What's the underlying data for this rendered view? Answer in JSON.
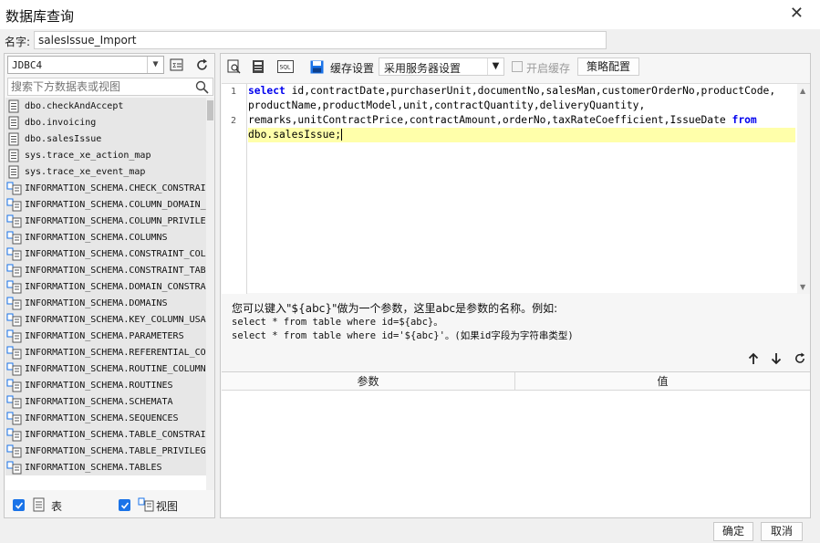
{
  "window": {
    "title": "数据库查询"
  },
  "name_field": {
    "label": "名字:",
    "value": "salesIssue_Import"
  },
  "left": {
    "connection": "JDBC4",
    "search_placeholder": "搜索下方数据表或视图",
    "items": [
      {
        "label": "dbo.checkAndAccept",
        "kind": "table"
      },
      {
        "label": "dbo.invoicing",
        "kind": "table"
      },
      {
        "label": "dbo.salesIssue",
        "kind": "table"
      },
      {
        "label": "sys.trace_xe_action_map",
        "kind": "table"
      },
      {
        "label": "sys.trace_xe_event_map",
        "kind": "table"
      },
      {
        "label": "INFORMATION_SCHEMA.CHECK_CONSTRAI",
        "kind": "view"
      },
      {
        "label": "INFORMATION_SCHEMA.COLUMN_DOMAIN_",
        "kind": "view"
      },
      {
        "label": "INFORMATION_SCHEMA.COLUMN_PRIVILE",
        "kind": "view"
      },
      {
        "label": "INFORMATION_SCHEMA.COLUMNS",
        "kind": "view"
      },
      {
        "label": "INFORMATION_SCHEMA.CONSTRAINT_COL",
        "kind": "view"
      },
      {
        "label": "INFORMATION_SCHEMA.CONSTRAINT_TAB",
        "kind": "view"
      },
      {
        "label": "INFORMATION_SCHEMA.DOMAIN_CONSTRA",
        "kind": "view"
      },
      {
        "label": "INFORMATION_SCHEMA.DOMAINS",
        "kind": "view"
      },
      {
        "label": "INFORMATION_SCHEMA.KEY_COLUMN_USA",
        "kind": "view"
      },
      {
        "label": "INFORMATION_SCHEMA.PARAMETERS",
        "kind": "view"
      },
      {
        "label": "INFORMATION_SCHEMA.REFERENTIAL_CO",
        "kind": "view"
      },
      {
        "label": "INFORMATION_SCHEMA.ROUTINE_COLUMN",
        "kind": "view"
      },
      {
        "label": "INFORMATION_SCHEMA.ROUTINES",
        "kind": "view"
      },
      {
        "label": "INFORMATION_SCHEMA.SCHEMATA",
        "kind": "view"
      },
      {
        "label": "INFORMATION_SCHEMA.SEQUENCES",
        "kind": "view"
      },
      {
        "label": "INFORMATION_SCHEMA.TABLE_CONSTRAI",
        "kind": "view"
      },
      {
        "label": "INFORMATION_SCHEMA.TABLE_PRIVILEG",
        "kind": "view"
      },
      {
        "label": "INFORMATION_SCHEMA.TABLES",
        "kind": "view"
      }
    ],
    "filter_table_label": "表",
    "filter_view_label": "视图",
    "filter_table_checked": true,
    "filter_view_checked": true
  },
  "toolbar": {
    "cache_settings_label": "缓存设置",
    "cache_mode": "采用服务器设置",
    "enable_cache_label": "开启缓存",
    "policy_button": "策略配置"
  },
  "editor": {
    "line_numbers": [
      "1",
      "2"
    ],
    "kw_select": "select",
    "kw_from": "from",
    "line1": " id,contractDate,purchaserUnit,documentNo,salesMan,customerOrderNo,productCode,",
    "line1b": "productName,productModel,unit,contractQuantity,deliveryQuantity,",
    "line2": "remarks,unitContractPrice,contractAmount,orderNo,taxRateCoefficient,IssueDate ",
    "line2b": "dbo.salesIssue;"
  },
  "hint": {
    "line1": "您可以键入\"${abc}\"做为一个参数，这里abc是参数的名称。例如:",
    "line2": "select * from table where id=${abc}。",
    "line3": "select * from table where id='${abc}'。(如果id字段为字符串类型)"
  },
  "params": {
    "col_param": "参数",
    "col_value": "值"
  },
  "footer": {
    "ok": "确定",
    "cancel": "取消"
  },
  "colors": {
    "accent": "#1a73e8",
    "keyword": "#0000ee",
    "highlight_line": "#ffffaa"
  }
}
